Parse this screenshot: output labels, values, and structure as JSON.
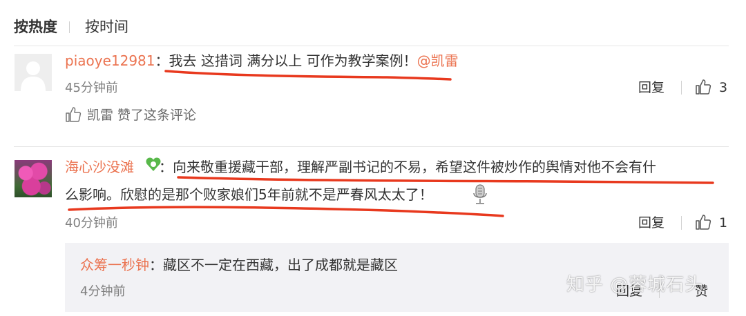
{
  "sort_tabs": {
    "by_heat": "按热度",
    "by_time": "按时间"
  },
  "comments": [
    {
      "username": "piaoye12981",
      "colon": "：",
      "text": "我去 这措词 满分以上 可作为教学案例！",
      "mention": "@凯雷",
      "time": "45分钟前",
      "reply_label": "回复",
      "like_count": "3",
      "liked_by": "凯雷 赞了这条评论"
    },
    {
      "username": "海心沙没滩",
      "colon": "：",
      "text_line1": "向来敬重援藏干部，理解严副书记的不易，希望这件被炒作的舆情对他不会有什",
      "text_line2": "么影响。欣慰的是那个败家娘们5年前就不是严春风太太了！",
      "time": "40分钟前",
      "reply_label": "回复",
      "like_count": "1"
    }
  ],
  "sub_reply": {
    "username": "众筹一秒钟",
    "colon": "：",
    "text": "藏区不一定在西藏，出了成都就是藏区",
    "time": "4分钟前",
    "reply_label": "回复",
    "like_label": "赞"
  },
  "watermark": "知乎 @蓉城石头",
  "colors": {
    "username": "#eb7350",
    "annotation": "#e8391e",
    "time": "#808080"
  },
  "icons": [
    "thumbs-up-icon",
    "default-avatar-icon",
    "voice-mic-icon",
    "member-badge-icon"
  ]
}
